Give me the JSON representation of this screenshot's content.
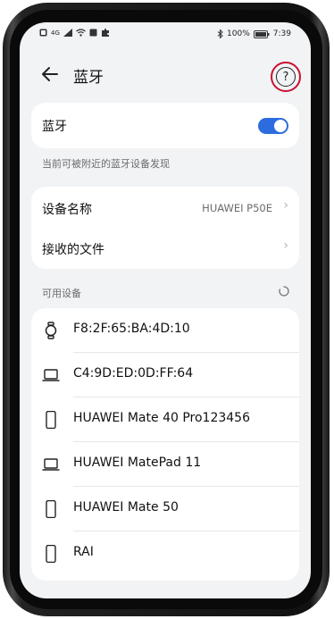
{
  "status_bar": {
    "signal_label": "4G",
    "battery_percent": "100%",
    "time": "7:39"
  },
  "header": {
    "title": "蓝牙",
    "help_icon": "?"
  },
  "bluetooth": {
    "label": "蓝牙",
    "enabled": true,
    "discoverable_hint": "当前可被附近的蓝牙设备发现"
  },
  "device_info": {
    "name_label": "设备名称",
    "name_value": "HUAWEI P50E",
    "received_files_label": "接收的文件"
  },
  "available": {
    "section_label": "可用设备",
    "devices": [
      {
        "name": "F8:2F:65:BA:4D:10",
        "icon": "watch-icon"
      },
      {
        "name": "C4:9D:ED:0D:FF:64",
        "icon": "laptop-icon"
      },
      {
        "name": "HUAWEI Mate 40 Pro123456",
        "icon": "phone-icon"
      },
      {
        "name": "HUAWEI MatePad 11",
        "icon": "laptop-icon"
      },
      {
        "name": "HUAWEI Mate 50",
        "icon": "phone-icon"
      },
      {
        "name": "RAI",
        "icon": "phone-icon"
      }
    ]
  },
  "colors": {
    "accent": "#2d6cdf",
    "highlight_circle": "#c8102e"
  }
}
